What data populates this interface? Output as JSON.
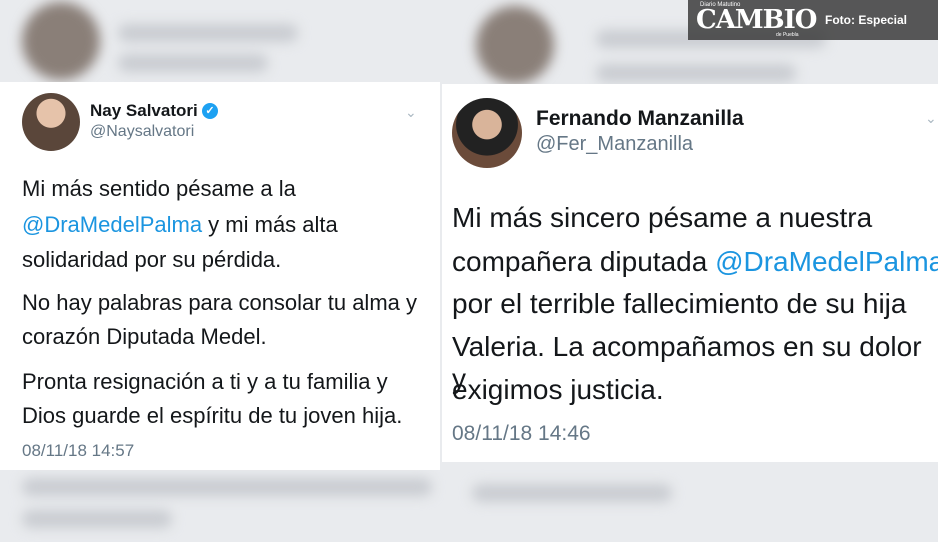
{
  "left_tweet": {
    "name": "Nay Salvatori",
    "handle": "@Naysalvatori",
    "p1_a": "Mi más sentido pésame a la",
    "p1_mention": "@DraMedelPalma",
    "p1_b": " y mi más alta",
    "p1_c": "solidaridad por su pérdida.",
    "p2_a": "No hay palabras para consolar tu alma y",
    "p2_b": "corazón Diputada Medel.",
    "p3_a": "Pronta resignación a ti y a tu familia y",
    "p3_b": "Dios guarde el espíritu de tu joven hija.",
    "time": "08/11/18 14:57"
  },
  "right_tweet": {
    "name": "Fernando Manzanilla",
    "handle": "@Fer_Manzanilla",
    "l1": "Mi más sincero pésame a nuestra",
    "l2_a": "compañera diputada ",
    "l2_mention": "@DraMedelPalma",
    "l3": "por el terrible fallecimiento de su hija",
    "l4": "Valeria. La acompañamos en su dolor y",
    "l5": "exigimos justicia.",
    "time": "08/11/18 14:46"
  },
  "branding": {
    "logo_top": "Diario Matutino",
    "logo": "CAMBIO",
    "logo_sub": "de Puebla",
    "credit": "Foto: Especial"
  },
  "icons": {
    "verified": "verified-check-icon",
    "chevron": "chevron-down-icon"
  },
  "colors": {
    "mention": "#1b95e0",
    "verified": "#1da1f2",
    "muted": "#657786"
  }
}
